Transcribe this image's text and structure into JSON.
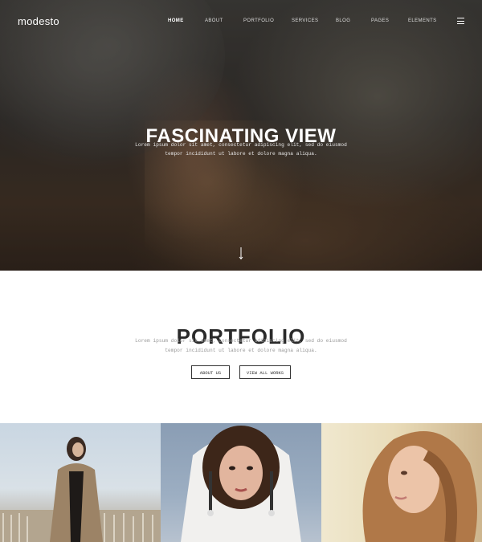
{
  "header": {
    "logo": "modesto",
    "nav": [
      "HOME",
      "ABOUT",
      "PORTFOLIO",
      "SERVICES",
      "BLOG",
      "PAGES",
      "ELEMENTS"
    ],
    "active_nav": "HOME",
    "menu_icon": "hamburger-icon"
  },
  "hero": {
    "title": "FASCINATING VIEW",
    "text_line1": "Lorem ipsum dolor sit amet, consectetur adipiscing elit, sed do eiusmod",
    "text_line2": "tempor incididunt ut labore et dolore magna aliqua.",
    "scroll_icon": "arrow-down-icon"
  },
  "portfolio": {
    "title": "PORTFOLIO",
    "text_line1": "Lorem ipsum dolor sit amet, consectetur adipiscing elit, sed do eiusmod",
    "text_line2": "tempor incididunt ut labore et dolore magna aliqua.",
    "about_button": "ABOUT US",
    "view_button": "VIEW ALL WORKS"
  },
  "colors": {
    "text_dark": "#2a2a2a",
    "text_muted": "#9a9a9a",
    "white": "#ffffff"
  }
}
